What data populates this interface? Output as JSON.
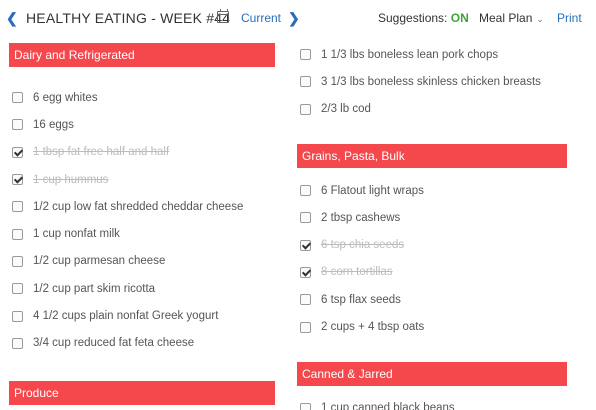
{
  "header": {
    "title": "HEALTHY EATING - WEEK #44",
    "current_label": "Current",
    "suggestions_label": "Suggestions:",
    "suggestions_state": "ON",
    "meal_plan_label": "Meal Plan",
    "print_label": "Print",
    "prev_icon": "chevron-left-icon",
    "next_icon": "chevron-right-icon",
    "calendar_icon": "calendar-icon"
  },
  "colors": {
    "accent": "#f4484d",
    "link": "#2a6ebb",
    "on_status": "#3aa63a",
    "done_text": "#bcbcbc"
  },
  "left_column": {
    "dairy": {
      "title": "Dairy and Refrigerated",
      "items": [
        {
          "label": "6 egg whites",
          "checked": false
        },
        {
          "label": "16 eggs",
          "checked": false
        },
        {
          "label": "1 tbsp fat free half and half",
          "checked": true
        },
        {
          "label": "1 cup hummus",
          "checked": true
        },
        {
          "label": "1/2 cup low fat shredded cheddar cheese",
          "checked": false
        },
        {
          "label": "1 cup nonfat milk",
          "checked": false
        },
        {
          "label": "1/2 cup parmesan cheese",
          "checked": false
        },
        {
          "label": "1/2 cup part skim ricotta",
          "checked": false
        },
        {
          "label": "4 1/2 cups plain nonfat Greek yogurt",
          "checked": false
        },
        {
          "label": "3/4 cup reduced fat feta cheese",
          "checked": false
        }
      ]
    },
    "produce": {
      "title": "Produce"
    }
  },
  "right_column": {
    "meat_items": [
      {
        "label": "1 1/3 lbs boneless lean pork chops",
        "checked": false
      },
      {
        "label": "3 1/3 lbs boneless skinless chicken breasts",
        "checked": false
      },
      {
        "label": "2/3 lb cod",
        "checked": false
      }
    ],
    "grains": {
      "title": "Grains, Pasta, Bulk",
      "items": [
        {
          "label": "6 Flatout light wraps",
          "checked": false
        },
        {
          "label": "2 tbsp cashews",
          "checked": false
        },
        {
          "label": "6 tsp chia seeds",
          "checked": true
        },
        {
          "label": "8 corn tortillas",
          "checked": true
        },
        {
          "label": "6 tsp flax seeds",
          "checked": false
        },
        {
          "label": "2 cups + 4 tbsp oats",
          "checked": false
        }
      ]
    },
    "canned": {
      "title": "Canned & Jarred",
      "items": [
        {
          "label": "1 cup canned black beans",
          "checked": false
        }
      ]
    }
  }
}
